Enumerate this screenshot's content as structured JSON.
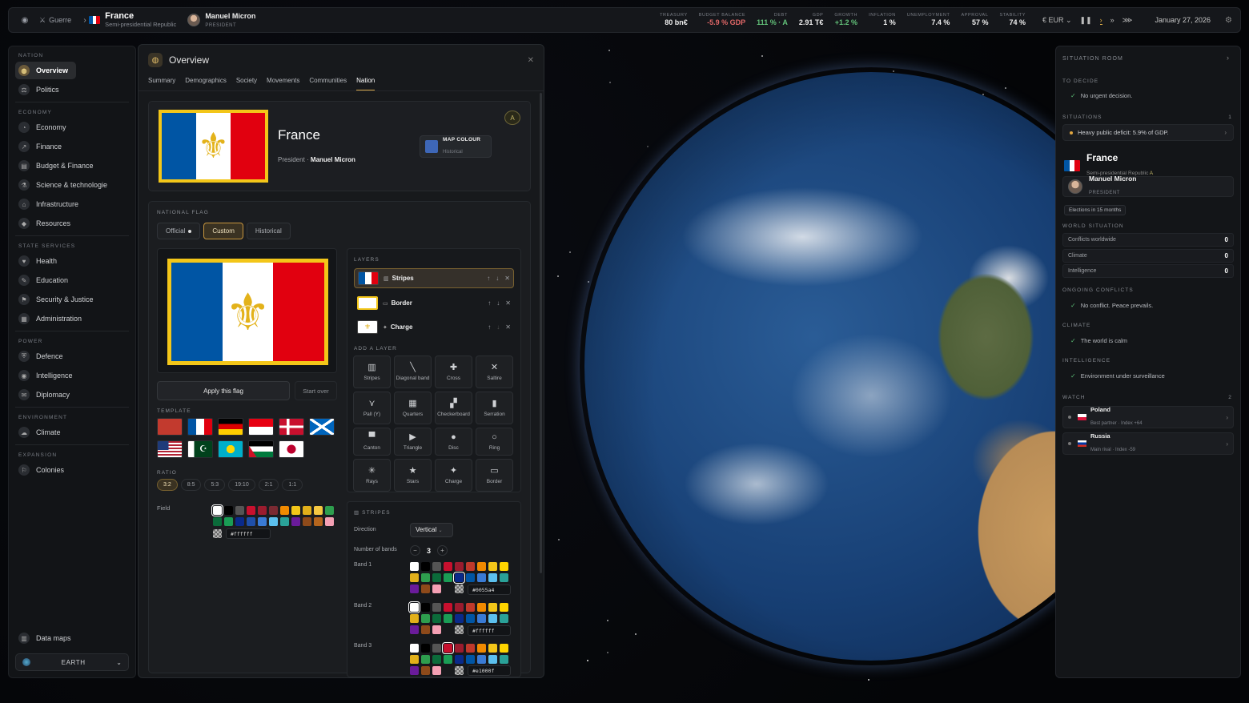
{
  "topbar": {
    "war_label": "Guerre",
    "country_name": "France",
    "country_regime": "Semi-presidential Republic",
    "leader_name": "Manuel Micron",
    "leader_role": "PRESIDENT",
    "stats": [
      {
        "key": "TREASURY",
        "value": "80 bn€",
        "tone": "normal"
      },
      {
        "key": "BUDGET BALANCE",
        "value": "-5.9 % GDP",
        "tone": "neg"
      },
      {
        "key": "DEBT",
        "value": "111 % · A",
        "tone": "pos"
      },
      {
        "key": "GDP",
        "value": "2.91 T€",
        "tone": "normal"
      },
      {
        "key": "GROWTH",
        "value": "+1.2 %",
        "tone": "pos"
      },
      {
        "key": "INFLATION",
        "value": "1 %",
        "tone": "normal"
      },
      {
        "key": "UNEMPLOYMENT",
        "value": "7.4 %",
        "tone": "normal"
      },
      {
        "key": "APPROVAL",
        "value": "57 %",
        "tone": "normal"
      },
      {
        "key": "STABILITY",
        "value": "74 %",
        "tone": "normal"
      }
    ],
    "currency": "€ EUR",
    "date": "January 27, 2026"
  },
  "nav": {
    "sections": [
      {
        "title": "NATION",
        "items": [
          "Overview",
          "Politics"
        ]
      },
      {
        "title": "ECONOMY",
        "items": [
          "Economy",
          "Finance",
          "Budget & Finance",
          "Science & technologie",
          "Infrastructure",
          "Resources"
        ]
      },
      {
        "title": "STATE SERVICES",
        "items": [
          "Health",
          "Education",
          "Security & Justice",
          "Administration"
        ]
      },
      {
        "title": "POWER",
        "items": [
          "Defence",
          "Intelligence",
          "Diplomacy"
        ]
      },
      {
        "title": "ENVIRONMENT",
        "items": [
          "Climate"
        ]
      },
      {
        "title": "EXPANSION",
        "items": [
          "Colonies"
        ]
      }
    ],
    "active": "Overview",
    "data_maps": "Data maps",
    "world": "EARTH"
  },
  "overview": {
    "title": "Overview",
    "tabs": [
      "Summary",
      "Demographics",
      "Society",
      "Movements",
      "Communities",
      "Nation"
    ],
    "active_tab": "Nation",
    "country": "France",
    "leader_prefix": "President ·",
    "leader": "Manuel Micron",
    "badge": "A",
    "map_colour_label": "MAP COLOUR",
    "map_colour_sub": "Historical",
    "map_colour_hex": "#3e67b7"
  },
  "flag": {
    "section_label": "NATIONAL FLAG",
    "modes": [
      "Official",
      "Custom",
      "Historical"
    ],
    "active_mode": "Custom",
    "apply": "Apply this flag",
    "start_over": "Start over",
    "template_label": "TEMPLATE",
    "ratio_label": "RATIO",
    "ratios": [
      "3:2",
      "8:5",
      "5:3",
      "19:10",
      "2:1",
      "1:1"
    ],
    "active_ratio": "3:2",
    "field_label": "Field",
    "field_hex": "#ffffff",
    "colors": {
      "blue": "#0055a4",
      "white": "#ffffff",
      "red": "#e1000f",
      "gold": "#f3c619"
    },
    "layers_label": "LAYERS",
    "layers": [
      {
        "name": "Stripes"
      },
      {
        "name": "Border"
      },
      {
        "name": "Charge"
      }
    ],
    "add_layer_label": "ADD A LAYER",
    "add_layer_buttons": [
      "Stripes",
      "Diagonal band",
      "Cross",
      "Saltire",
      "Pall (Y)",
      "Quarters",
      "Checkerboard",
      "Serration",
      "Canton",
      "Triangle",
      "Disc",
      "Ring",
      "Rays",
      "Stars",
      "Charge",
      "Border"
    ],
    "stripes_label": "STRIPES",
    "direction_label": "Direction",
    "direction": "Vertical",
    "bands_label": "Number of bands",
    "bands_count": "3",
    "band_labels": [
      "Band 1",
      "Band 2",
      "Band 3"
    ],
    "band_hex": [
      "#0055a4",
      "#ffffff",
      "#e1000f"
    ]
  },
  "situation": {
    "title": "SITUATION ROOM",
    "to_decide_label": "TO DECIDE",
    "to_decide": "No urgent decision.",
    "situations_label": "SITUATIONS",
    "situations_count": "1",
    "situation_item": "Heavy public deficit: 5.9% of GDP.",
    "country": "France",
    "regime": "Semi-presidential Republic",
    "grade": "A",
    "leader": "Manuel Micron",
    "leader_role": "PRESIDENT",
    "elections": "Elections in 15 months",
    "world_label": "WORLD SITUATION",
    "world_rows": [
      {
        "label": "Conflicts worldwide",
        "value": "0"
      },
      {
        "label": "Climate",
        "value": "0"
      },
      {
        "label": "Intelligence",
        "value": "0"
      }
    ],
    "conflicts_label": "ONGOING CONFLICTS",
    "conflicts": "No conflict. Peace prevails.",
    "climate_label": "CLIMATE",
    "climate": "The world is calm",
    "intel_label": "INTELLIGENCE",
    "intel": "Environment under surveillance",
    "watch_label": "WATCH",
    "watch_count": "2",
    "watch": [
      {
        "name": "Poland",
        "sub": "Best partner · Index +64"
      },
      {
        "name": "Russia",
        "sub": "Main rival · Index -59"
      }
    ]
  }
}
